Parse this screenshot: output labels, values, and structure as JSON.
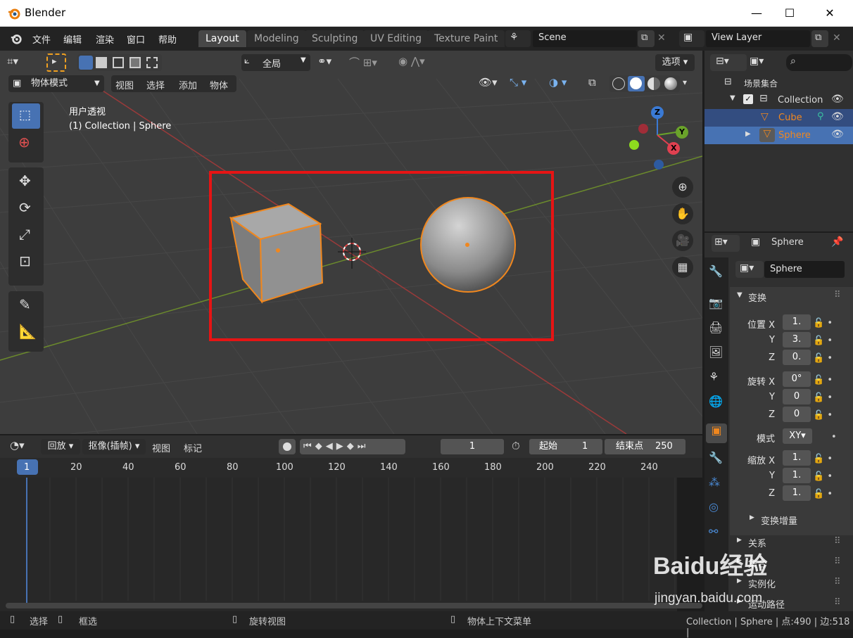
{
  "window": {
    "title": "Blender",
    "min": "—",
    "max": "☐",
    "close": "✕"
  },
  "menu": [
    "文件",
    "编辑",
    "渲染",
    "窗口",
    "帮助"
  ],
  "workspaces": [
    "Layout",
    "Modeling",
    "Sculpting",
    "UV Editing",
    "Texture Paint"
  ],
  "scene": {
    "name": "Scene",
    "view_layer": "View Layer"
  },
  "viewport": {
    "transform_orient": "全局",
    "options": "选项",
    "mode": "物体模式",
    "header_menu": [
      "视图",
      "选择",
      "添加",
      "物体"
    ],
    "overlay_title": "用户透视",
    "overlay_sub": "(1) Collection | Sphere",
    "gizmo": {
      "x": "X",
      "y": "Y",
      "z": "Z"
    }
  },
  "outliner": {
    "scene_collection": "场景集合",
    "collection": "Collection",
    "items": [
      "Cube",
      "Sphere"
    ]
  },
  "properties": {
    "object_name": "Sphere",
    "data_name": "Sphere",
    "transform_title": "变换",
    "location_label": "位置 X",
    "rotation_label": "旋转 X",
    "mode_label": "模式",
    "mode_value": "XY",
    "scale_label": "缩放 X",
    "y": "Y",
    "z": "Z",
    "loc": [
      "1.",
      "3.",
      "0."
    ],
    "rot": [
      "0°",
      "0",
      "0"
    ],
    "scale": [
      "1.",
      "1.",
      "1."
    ],
    "delta": "变换增量",
    "sections": [
      "关系",
      "集合",
      "实例化",
      "运动路径"
    ]
  },
  "timeline": {
    "menu": [
      "回放",
      "抠像(插帧)",
      "视图",
      "标记"
    ],
    "current_frame": "1",
    "start_label": "起始",
    "start": "1",
    "end_label": "结束点",
    "end": "250",
    "ticks": [
      "1",
      "20",
      "40",
      "60",
      "80",
      "100",
      "120",
      "140",
      "160",
      "180",
      "200",
      "220",
      "240"
    ]
  },
  "status": {
    "select": "选择",
    "box": "框选",
    "rotate": "旋转视图",
    "context": "物体上下文菜单",
    "right": "Collection | Sphere | 点:490 | 边:518 |"
  },
  "watermark": {
    "brand": "Baidu经验",
    "url": "jingyan.baidu.com"
  },
  "colors": {
    "accent": "#4772b3",
    "selected": "#f0871e",
    "highlight": "#e61414"
  }
}
